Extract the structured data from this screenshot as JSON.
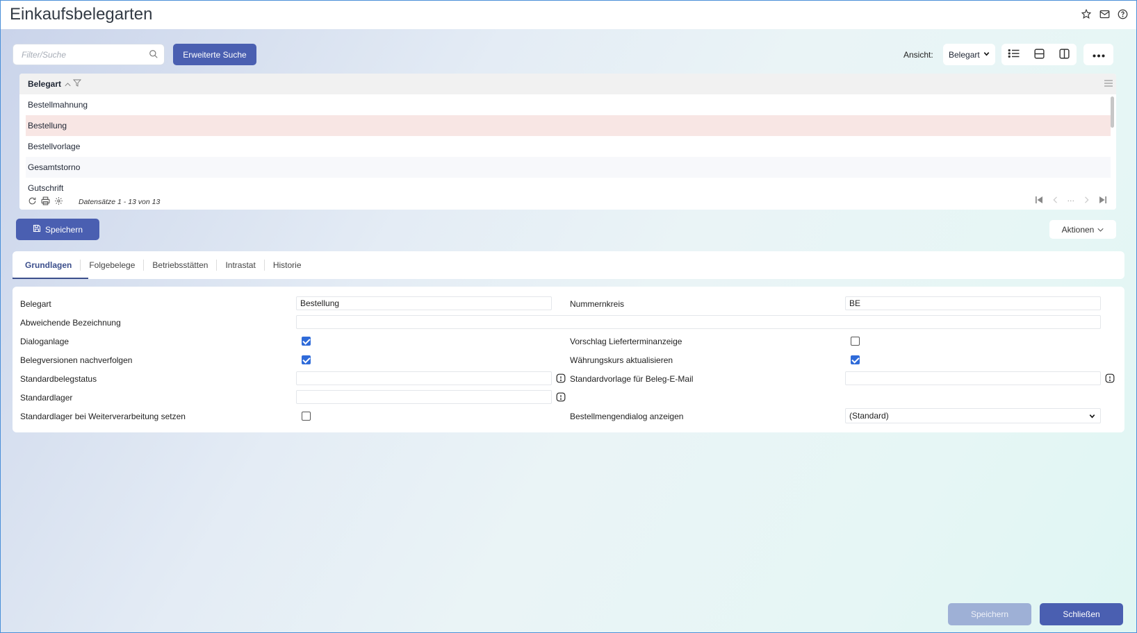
{
  "window": {
    "title": "Einkaufsbelegarten"
  },
  "toolbar": {
    "search_placeholder": "Filter/Suche",
    "advanced_search_label": "Erweiterte Suche",
    "view_label": "Ansicht:",
    "view_value": "Belegart"
  },
  "grid": {
    "column_header": "Belegart",
    "rows": [
      "Bestellmahnung",
      "Bestellung",
      "Bestellvorlage",
      "Gesamtstorno",
      "Gutschrift"
    ],
    "selected_row": "Bestellung",
    "record_info": "Datensätze 1 - 13 von 13",
    "pager_ellipsis": "···"
  },
  "actions": {
    "save_label": "Speichern",
    "aktionen_label": "Aktionen"
  },
  "tabs": [
    "Grundlagen",
    "Folgebelege",
    "Betriebsstätten",
    "Intrastat",
    "Historie"
  ],
  "active_tab": "Grundlagen",
  "form": {
    "belegart_label": "Belegart",
    "belegart_value": "Bestellung",
    "nummernkreis_label": "Nummernkreis",
    "nummernkreis_value": "BE",
    "abweichende_label": "Abweichende Bezeichnung",
    "abweichende_value": "",
    "dialoganlage_label": "Dialoganlage",
    "dialoganlage_checked": true,
    "vorschlag_label": "Vorschlag Lieferterminanzeige",
    "vorschlag_checked": false,
    "belegversionen_label": "Belegversionen nachverfolgen",
    "belegversionen_checked": true,
    "waehrungskurs_label": "Währungskurs aktualisieren",
    "waehrungskurs_checked": true,
    "standardbelegstatus_label": "Standardbelegstatus",
    "standardvorlage_label": "Standardvorlage für Beleg-E-Mail",
    "standardlager_label": "Standardlager",
    "standardlager_weiter_label": "Standardlager bei Weiterverarbeitung setzen",
    "standardlager_weiter_checked": false,
    "bestellmengendialog_label": "Bestellmengendialog anzeigen",
    "bestellmengendialog_value": "(Standard)"
  },
  "footer": {
    "save_label": "Speichern",
    "close_label": "Schließen"
  },
  "colors": {
    "primary": "#4a5fb1",
    "selected_row": "#f8e6e4",
    "checkbox": "#2f6bd9",
    "disabled_button": "#9eb0d6"
  }
}
